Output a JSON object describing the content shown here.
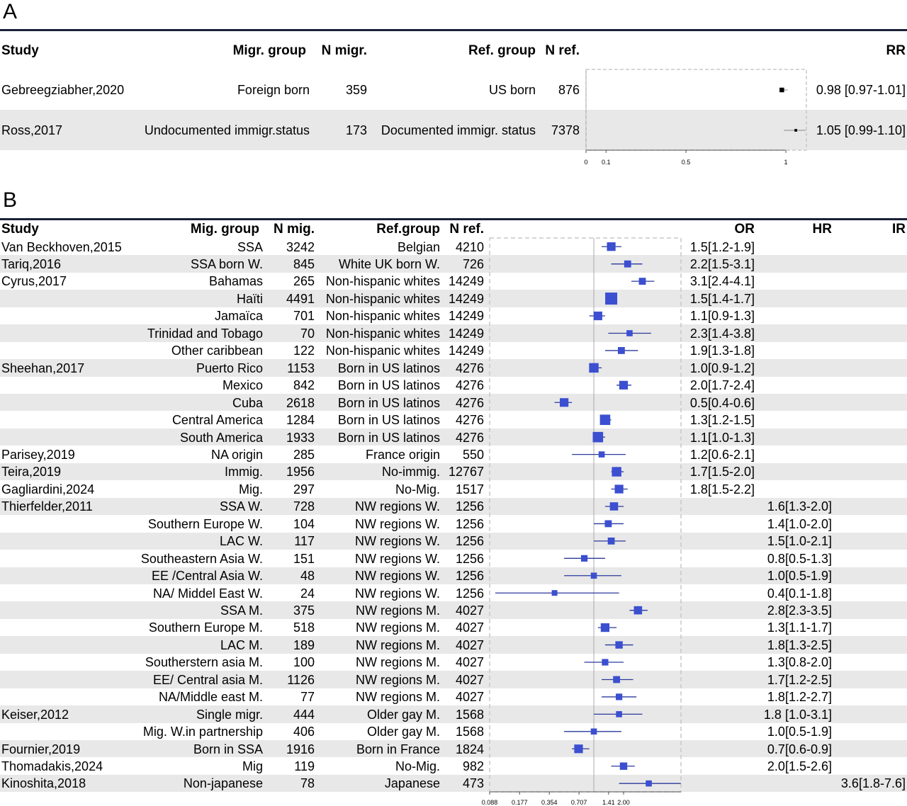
{
  "panelA": {
    "label": "A",
    "headers": {
      "study": "Study",
      "migr_group": "Migr. group",
      "n_migr": "N migr.",
      "ref_group": "Ref. group",
      "n_ref": "N ref.",
      "rr": "RR"
    },
    "rows": [
      {
        "study": "Gebreegziabher,2020",
        "migr_group": "Foreign born",
        "n_migr": "359",
        "ref_group": "US born",
        "n_ref": "876",
        "rr_text": "0.98 [0.97-1.01]"
      },
      {
        "study": "Ross,2017",
        "migr_group": "Undocumented immigr.status",
        "n_migr": "173",
        "ref_group": "Documented immigr. status",
        "n_ref": "7378",
        "rr_text": "1.05 [0.99-1.10]"
      }
    ],
    "axis_ticks": [
      "0",
      "0.1",
      "0.5",
      "1"
    ]
  },
  "panelB": {
    "label": "B",
    "headers": {
      "study": "Study",
      "mig_group": "Mig. group",
      "n_mig": "N mig.",
      "ref_group": "Ref.group",
      "n_ref": "N ref.",
      "or": "OR",
      "hr": "HR",
      "ir": "IR"
    },
    "rows": [
      {
        "study": "Van Beckhoven,2015",
        "mig_group": "SSA",
        "n_mig": "3242",
        "ref_group": "Belgian",
        "n_ref": "4210",
        "or": "1.5[1.2-1.9]",
        "hr": "",
        "ir": ""
      },
      {
        "study": "Tariq,2016",
        "mig_group": "SSA born W.",
        "n_mig": "845",
        "ref_group": "White UK born W.",
        "n_ref": "726",
        "or": "2.2[1.5-3.1]",
        "hr": "",
        "ir": ""
      },
      {
        "study": "Cyrus,2017",
        "mig_group": "Bahamas",
        "n_mig": "265",
        "ref_group": "Non-hispanic whites",
        "n_ref": "14249",
        "or": "3.1[2.4-4.1]",
        "hr": "",
        "ir": ""
      },
      {
        "study": "",
        "mig_group": "Haïti",
        "n_mig": "4491",
        "ref_group": "Non-hispanic whites",
        "n_ref": "14249",
        "or": "1.5[1.4-1.7]",
        "hr": "",
        "ir": ""
      },
      {
        "study": "",
        "mig_group": "Jamaïca",
        "n_mig": "701",
        "ref_group": "Non-hispanic whites",
        "n_ref": "14249",
        "or": "1.1[0.9-1.3]",
        "hr": "",
        "ir": ""
      },
      {
        "study": "",
        "mig_group": "Trinidad and Tobago",
        "n_mig": "70",
        "ref_group": "Non-hispanic whites",
        "n_ref": "14249",
        "or": "2.3[1.4-3.8]",
        "hr": "",
        "ir": ""
      },
      {
        "study": "",
        "mig_group": "Other caribbean",
        "n_mig": "122",
        "ref_group": "Non-hispanic whites",
        "n_ref": "14249",
        "or": "1.9[1.3-1.8]",
        "hr": "",
        "ir": ""
      },
      {
        "study": "Sheehan,2017",
        "mig_group": "Puerto Rico",
        "n_mig": "1153",
        "ref_group": "Born in US latinos",
        "n_ref": "4276",
        "or": "1.0[0.9-1.2]",
        "hr": "",
        "ir": ""
      },
      {
        "study": "",
        "mig_group": "Mexico",
        "n_mig": "842",
        "ref_group": "Born in US latinos",
        "n_ref": "4276",
        "or": "2.0[1.7-2.4]",
        "hr": "",
        "ir": ""
      },
      {
        "study": "",
        "mig_group": "Cuba",
        "n_mig": "2618",
        "ref_group": "Born in US latinos",
        "n_ref": "4276",
        "or": "0.5[0.4-0.6]",
        "hr": "",
        "ir": ""
      },
      {
        "study": "",
        "mig_group": "Central America",
        "n_mig": "1284",
        "ref_group": "Born in US latinos",
        "n_ref": "4276",
        "or": "1.3[1.2-1.5]",
        "hr": "",
        "ir": ""
      },
      {
        "study": "",
        "mig_group": "South America",
        "n_mig": "1933",
        "ref_group": "Born in US latinos",
        "n_ref": "4276",
        "or": "1.1[1.0-1.3]",
        "hr": "",
        "ir": ""
      },
      {
        "study": "Parisey,2019",
        "mig_group": "NA origin",
        "n_mig": "285",
        "ref_group": "France origin",
        "n_ref": "550",
        "or": "1.2[0.6-2.1]",
        "hr": "",
        "ir": ""
      },
      {
        "study": "Teira,2019",
        "mig_group": "Immig.",
        "n_mig": "1956",
        "ref_group": "No-immig.",
        "n_ref": "12767",
        "or": "1.7[1.5-2.0]",
        "hr": "",
        "ir": ""
      },
      {
        "study": "Gagliardini,2024",
        "mig_group": "Mig.",
        "n_mig": "297",
        "ref_group": "No-Mig.",
        "n_ref": "1517",
        "or": "1.8[1.5-2.2]",
        "hr": "",
        "ir": ""
      },
      {
        "study": "Thierfelder,2011",
        "mig_group": "SSA W.",
        "n_mig": "728",
        "ref_group": "NW regions W.",
        "n_ref": "1256",
        "or": "",
        "hr": "1.6[1.3-2.0]",
        "ir": ""
      },
      {
        "study": "",
        "mig_group": "Southern Europe W.",
        "n_mig": "104",
        "ref_group": "NW regions W.",
        "n_ref": "1256",
        "or": "",
        "hr": "1.4[1.0-2.0]",
        "ir": ""
      },
      {
        "study": "",
        "mig_group": "LAC W.",
        "n_mig": "117",
        "ref_group": "NW regions W.",
        "n_ref": "1256",
        "or": "",
        "hr": "1.5[1.0-2.1]",
        "ir": ""
      },
      {
        "study": "",
        "mig_group": "Southeastern Asia W.",
        "n_mig": "151",
        "ref_group": "NW regions W.",
        "n_ref": "1256",
        "or": "",
        "hr": "0.8[0.5-1.3]",
        "ir": ""
      },
      {
        "study": "",
        "mig_group": "EE /Central Asia W.",
        "n_mig": "48",
        "ref_group": "NW regions W.",
        "n_ref": "1256",
        "or": "",
        "hr": "1.0[0.5-1.9]",
        "ir": ""
      },
      {
        "study": "",
        "mig_group": "NA/ Middel East W.",
        "n_mig": "24",
        "ref_group": "NW regions W.",
        "n_ref": "1256",
        "or": "",
        "hr": "0.4[0.1-1.8]",
        "ir": ""
      },
      {
        "study": "",
        "mig_group": "SSA M.",
        "n_mig": "375",
        "ref_group": "NW regions M.",
        "n_ref": "4027",
        "or": "",
        "hr": "2.8[2.3-3.5]",
        "ir": ""
      },
      {
        "study": "",
        "mig_group": "Southern Europe M.",
        "n_mig": "518",
        "ref_group": "NW regions M.",
        "n_ref": "4027",
        "or": "",
        "hr": "1.3[1.1-1.7]",
        "ir": ""
      },
      {
        "study": "",
        "mig_group": "LAC M.",
        "n_mig": "189",
        "ref_group": "NW regions M.",
        "n_ref": "4027",
        "or": "",
        "hr": "1.8[1.3-2.5]",
        "ir": ""
      },
      {
        "study": "",
        "mig_group": "Southerstern asia M.",
        "n_mig": "100",
        "ref_group": "NW regions M.",
        "n_ref": "4027",
        "or": "",
        "hr": "1.3[0.8-2.0]",
        "ir": ""
      },
      {
        "study": "",
        "mig_group": "EE/ Central asia M.",
        "n_mig": "1126",
        "ref_group": "NW regions M.",
        "n_ref": "4027",
        "or": "",
        "hr": "1.7[1.2-2.5]",
        "ir": ""
      },
      {
        "study": "",
        "mig_group": "NA/Middle east M.",
        "n_mig": "77",
        "ref_group": "NW regions M.",
        "n_ref": "4027",
        "or": "",
        "hr": "1.8[1.2-2.7]",
        "ir": ""
      },
      {
        "study": "Keiser,2012",
        "mig_group": "Single migr.",
        "n_mig": "444",
        "ref_group": "Older gay M.",
        "n_ref": "1568",
        "or": "",
        "hr": "1.8 [1.0-3.1]",
        "ir": ""
      },
      {
        "study": "",
        "mig_group": "Mig. W.in partnership",
        "n_mig": "406",
        "ref_group": "Older gay M.",
        "n_ref": "1568",
        "or": "",
        "hr": "1.0[0.5-1.9]",
        "ir": ""
      },
      {
        "study": "Fournier,2019",
        "mig_group": "Born in SSA",
        "n_mig": "1916",
        "ref_group": "Born in France",
        "n_ref": "1824",
        "or": "",
        "hr": "0.7[0.6-0.9]",
        "ir": ""
      },
      {
        "study": "Thomadakis,2024",
        "mig_group": "Mig",
        "n_mig": "119",
        "ref_group": "No-Mig.",
        "n_ref": "982",
        "or": "",
        "hr": "2.0[1.5-2.6]",
        "ir": ""
      },
      {
        "study": "Kinoshita,2018",
        "mig_group": "Non-japanese",
        "n_mig": "78",
        "ref_group": "Japanese",
        "n_ref": "473",
        "or": "",
        "hr": "",
        "ir": "3.6[1.8-7.6]"
      }
    ],
    "axis_ticks": [
      "0.088",
      "0.177",
      "0.354",
      "0.707",
      "1.41",
      "2.00"
    ]
  },
  "chart_data": [
    {
      "type": "scatter",
      "subtype": "forest",
      "scale": "linear",
      "xlim": [
        0,
        1.1
      ],
      "reference_line": 0,
      "xticks": [
        0,
        0.1,
        0.5,
        1
      ],
      "rows": [
        {
          "est": 0.98,
          "lo": 0.97,
          "hi": 1.01,
          "weight": 0.9
        },
        {
          "est": 1.05,
          "lo": 0.99,
          "hi": 1.1,
          "weight": 0.35
        }
      ]
    },
    {
      "type": "scatter",
      "subtype": "forest",
      "scale": "log2",
      "xlim": [
        0.088,
        4.0
      ],
      "reference_line": 1.0,
      "xticks": [
        0.088,
        0.177,
        0.354,
        0.707,
        1.41,
        2.0
      ],
      "rows": [
        {
          "est": 1.5,
          "lo": 1.2,
          "hi": 1.9,
          "weight": 0.6
        },
        {
          "est": 2.2,
          "lo": 1.5,
          "hi": 3.1,
          "weight": 0.4
        },
        {
          "est": 3.1,
          "lo": 2.4,
          "hi": 4.1,
          "weight": 0.4
        },
        {
          "est": 1.5,
          "lo": 1.4,
          "hi": 1.7,
          "weight": 1.0
        },
        {
          "est": 1.1,
          "lo": 0.9,
          "hi": 1.3,
          "weight": 0.6
        },
        {
          "est": 2.3,
          "lo": 1.4,
          "hi": 3.8,
          "weight": 0.3
        },
        {
          "est": 1.9,
          "lo": 1.3,
          "hi": 2.8,
          "weight": 0.4
        },
        {
          "est": 1.0,
          "lo": 0.9,
          "hi": 1.2,
          "weight": 0.7
        },
        {
          "est": 2.0,
          "lo": 1.7,
          "hi": 2.4,
          "weight": 0.6
        },
        {
          "est": 0.5,
          "lo": 0.4,
          "hi": 0.6,
          "weight": 0.6
        },
        {
          "est": 1.3,
          "lo": 1.2,
          "hi": 1.5,
          "weight": 0.8
        },
        {
          "est": 1.1,
          "lo": 1.0,
          "hi": 1.3,
          "weight": 0.8
        },
        {
          "est": 1.2,
          "lo": 0.6,
          "hi": 2.1,
          "weight": 0.3
        },
        {
          "est": 1.7,
          "lo": 1.5,
          "hi": 2.0,
          "weight": 0.7
        },
        {
          "est": 1.8,
          "lo": 1.5,
          "hi": 2.2,
          "weight": 0.6
        },
        {
          "est": 1.6,
          "lo": 1.3,
          "hi": 2.0,
          "weight": 0.55
        },
        {
          "est": 1.4,
          "lo": 1.0,
          "hi": 2.0,
          "weight": 0.4
        },
        {
          "est": 1.5,
          "lo": 1.0,
          "hi": 2.1,
          "weight": 0.4
        },
        {
          "est": 0.8,
          "lo": 0.5,
          "hi": 1.3,
          "weight": 0.35
        },
        {
          "est": 1.0,
          "lo": 0.5,
          "hi": 1.9,
          "weight": 0.3
        },
        {
          "est": 0.4,
          "lo": 0.1,
          "hi": 1.8,
          "weight": 0.25
        },
        {
          "est": 2.8,
          "lo": 2.3,
          "hi": 3.5,
          "weight": 0.55
        },
        {
          "est": 1.3,
          "lo": 1.1,
          "hi": 1.7,
          "weight": 0.6
        },
        {
          "est": 1.8,
          "lo": 1.3,
          "hi": 2.5,
          "weight": 0.45
        },
        {
          "est": 1.3,
          "lo": 0.8,
          "hi": 2.0,
          "weight": 0.35
        },
        {
          "est": 1.7,
          "lo": 1.2,
          "hi": 2.5,
          "weight": 0.4
        },
        {
          "est": 1.8,
          "lo": 1.2,
          "hi": 2.7,
          "weight": 0.35
        },
        {
          "est": 1.8,
          "lo": 1.0,
          "hi": 3.1,
          "weight": 0.3
        },
        {
          "est": 1.0,
          "lo": 0.5,
          "hi": 1.9,
          "weight": 0.3
        },
        {
          "est": 0.7,
          "lo": 0.6,
          "hi": 0.9,
          "weight": 0.6
        },
        {
          "est": 2.0,
          "lo": 1.5,
          "hi": 2.6,
          "weight": 0.45
        },
        {
          "est": 3.6,
          "lo": 1.8,
          "hi": 7.6,
          "weight": 0.3
        }
      ]
    }
  ],
  "colors": {
    "marker": "#3b4fd0",
    "ci_line": "#2a3a9c",
    "stripe": "#e8e8e8",
    "rule": "#1a1f3a",
    "ref_line": "#aaaaaa",
    "box": "#c8c8c8"
  }
}
